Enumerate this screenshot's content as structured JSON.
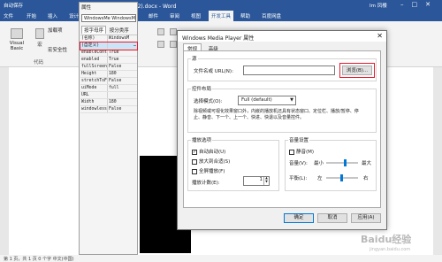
{
  "word": {
    "autosave": "自动保存",
    "doc_title": "Word 文档 (2).docx  -  Word",
    "user": "Im 凤楼",
    "tabs": [
      "文件",
      "开始",
      "插入",
      "设计",
      "布局",
      "引用",
      "邮件",
      "审阅",
      "视图",
      "开发工具",
      "帮助",
      "百度网盘"
    ],
    "active_tab": "开发工具",
    "visual_basic": "Visual Basic",
    "macro": "宏",
    "addin": "加载项",
    "security": "宏安全性",
    "code_group": "代码",
    "statusbar": "第 1 页，共 1 页   0 个字   中文(中国)"
  },
  "properties": {
    "title": "属性",
    "control": "WindowsMe WindowsMedi",
    "tabs": [
      "按字母序",
      "按分类序"
    ],
    "rows": [
      {
        "name": "(名称)",
        "value": "WindowsM"
      },
      {
        "name": "(自定义)",
        "value": "",
        "selected": true
      },
      {
        "name": "enableContext",
        "value": "True"
      },
      {
        "name": "enabled",
        "value": "True"
      },
      {
        "name": "fullScreen",
        "value": "False"
      },
      {
        "name": "Height",
        "value": "180"
      },
      {
        "name": "stretchToFit",
        "value": "False"
      },
      {
        "name": "uiMode",
        "value": "full"
      },
      {
        "name": "URL",
        "value": ""
      },
      {
        "name": "Width",
        "value": "180"
      },
      {
        "name": "windowlessVid",
        "value": "False"
      }
    ]
  },
  "dialog": {
    "title": "Windows Media Player 属性",
    "tabs": [
      "常规",
      "高级"
    ],
    "source_legend": "源",
    "url_label": "文件名或 URL(N):",
    "browse": "浏览(B)...",
    "layout_legend": "控件布局",
    "mode_label": "选择模式(O):",
    "mode_value": "Full (default)",
    "mode_desc": "除视频或可视化效果窗口外，内嵌的播放机还具有状态窗口、定位栏、播放/暂停、停止、静音、下一个、上一个、快进、快退以及音量控件。",
    "playback_legend": "播放选项",
    "autostart": "自动启动(U)",
    "stretch": "放大到合适(S)",
    "fullscreen": "全屏播放(F)",
    "playcount_label": "播放计数(E):",
    "playcount": "1",
    "volume_legend": "音量设置",
    "mute": "静音(M)",
    "volume_label": "音量(V):",
    "vol_min": "最小",
    "vol_max": "最大",
    "balance_label": "平衡(L):",
    "bal_left": "左",
    "bal_right": "右",
    "ok": "确定",
    "cancel": "取消",
    "apply": "应用(A)"
  },
  "watermark": {
    "text": "Baidu经验",
    "sub": "jingyan.baidu.com"
  },
  "colors": {
    "ribbon": "#2b579a",
    "highlight": "#e8172b",
    "accent": "#0078d7"
  }
}
